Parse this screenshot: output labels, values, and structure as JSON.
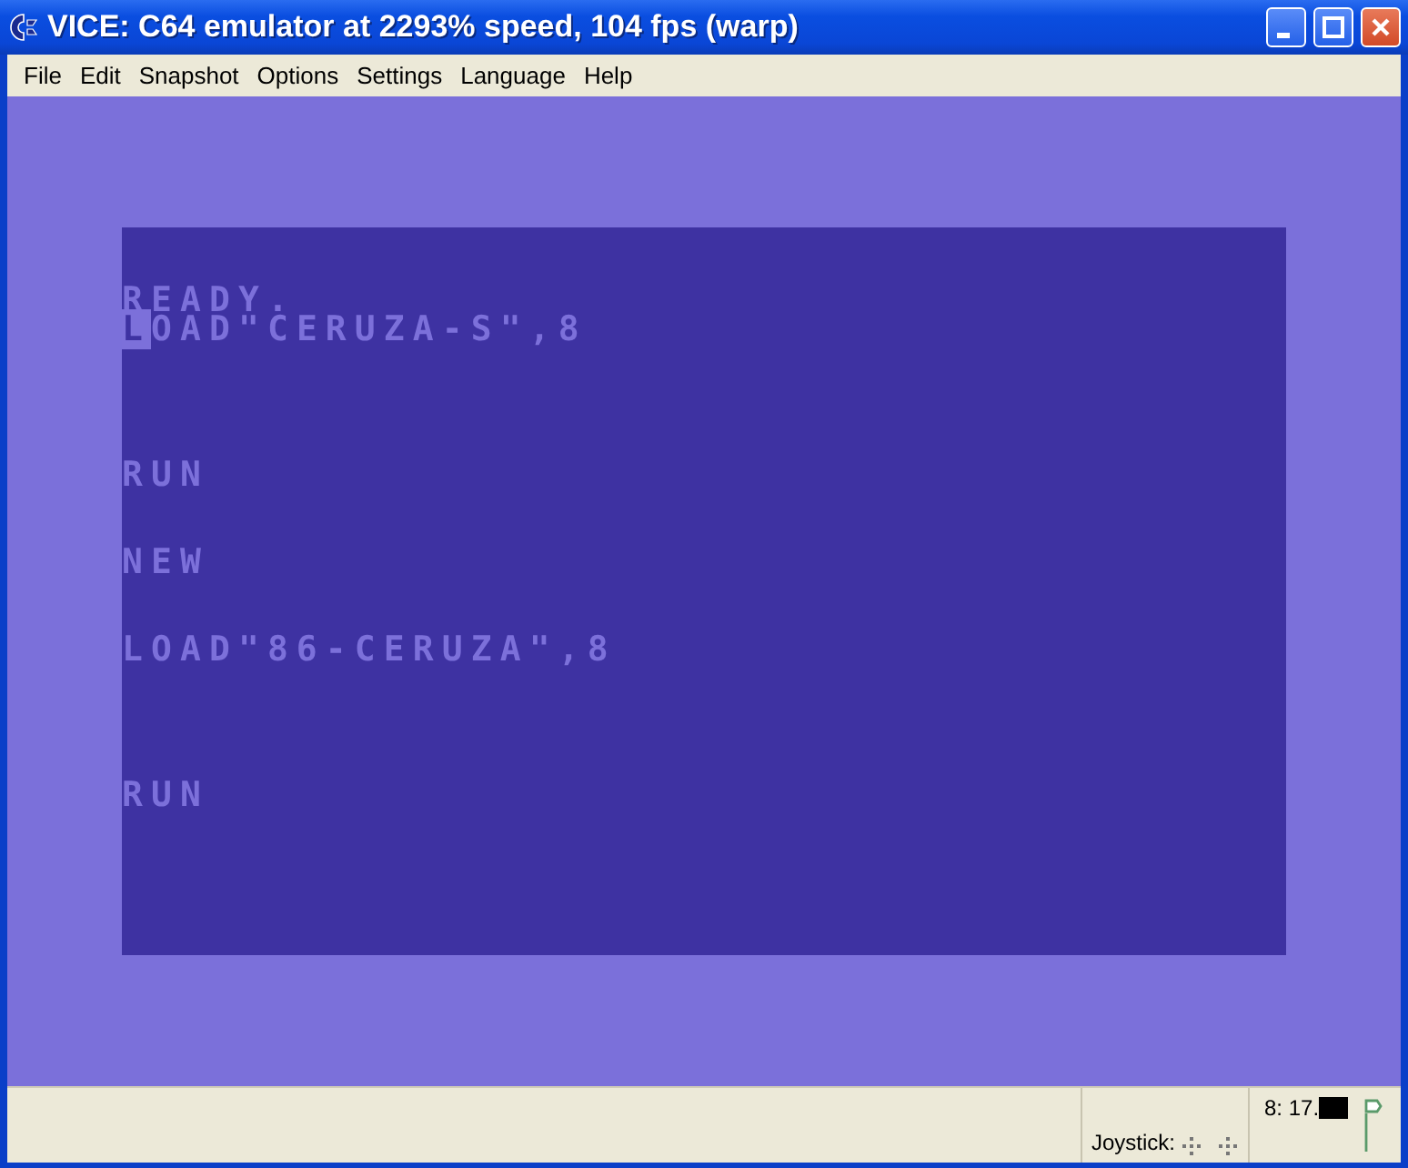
{
  "window": {
    "title": "VICE: C64 emulator at 2293% speed, 104 fps (warp)"
  },
  "menu": [
    "File",
    "Edit",
    "Snapshot",
    "Options",
    "Settings",
    "Language",
    "Help"
  ],
  "screen_lines": [
    {
      "text": "READY.",
      "cursor": false
    },
    {
      "text": "LOAD\"CERUZA-S\",8",
      "cursor": true
    },
    {
      "text": "RUN",
      "cursor": false
    },
    {
      "text": "NEW",
      "cursor": false
    },
    {
      "text": "LOAD\"86-CERUZA\",8",
      "cursor": false
    },
    {
      "text": "RUN",
      "cursor": false
    }
  ],
  "status_bar": {
    "joystick_label": "Joystick:",
    "drive_status": "8: 17."
  }
}
